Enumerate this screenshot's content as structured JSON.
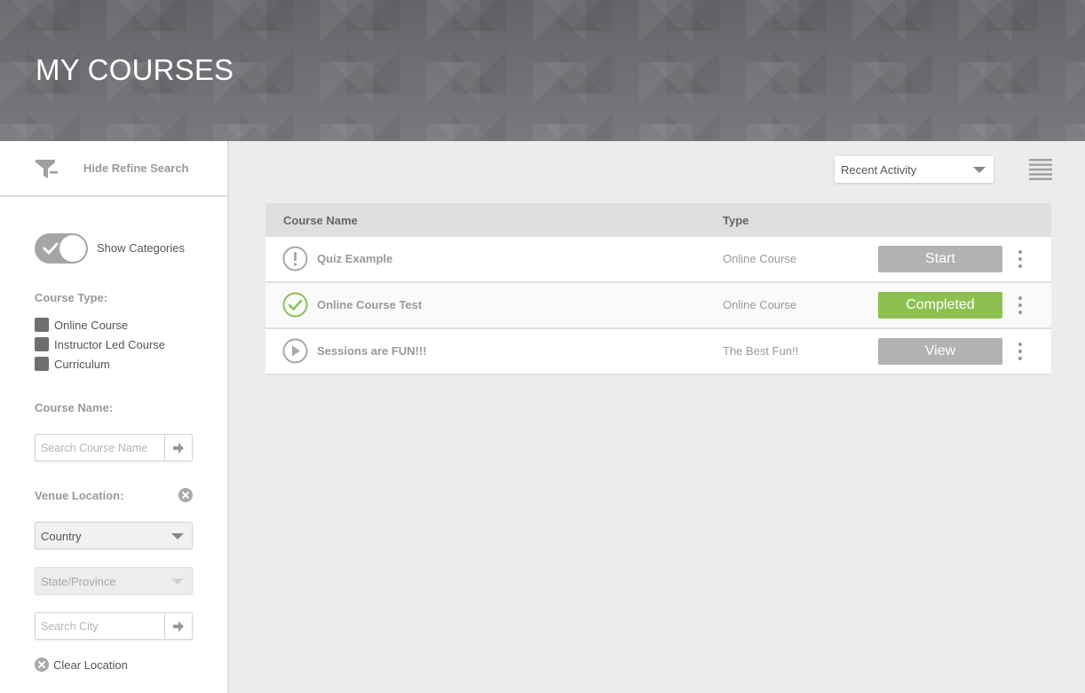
{
  "header": {
    "title": "MY COURSES"
  },
  "sidebar": {
    "refine_label": "Hide Refine Search",
    "show_categories_label": "Show Categories",
    "show_categories_on": true,
    "course_type": {
      "label": "Course Type:",
      "options": [
        {
          "label": "Online Course"
        },
        {
          "label": "Instructor Led Course"
        },
        {
          "label": "Curriculum"
        }
      ]
    },
    "course_name": {
      "label": "Course Name:",
      "placeholder": "Search Course Name"
    },
    "venue": {
      "label": "Venue Location:",
      "country": "Country",
      "state": "State/Province",
      "city_placeholder": "Search City",
      "clear_label": "Clear Location"
    }
  },
  "main": {
    "sort": {
      "selected": "Recent Activity"
    },
    "table": {
      "headers": {
        "name": "Course Name",
        "type": "Type"
      },
      "rows": [
        {
          "name": "Quiz Example",
          "type": "Online Course",
          "action": "Start",
          "status": "alert"
        },
        {
          "name": "Online Course Test",
          "type": "Online Course",
          "action": "Completed",
          "status": "completed"
        },
        {
          "name": "Sessions are FUN!!!",
          "type": "The Best Fun!!",
          "action": "View",
          "status": "play"
        }
      ]
    }
  },
  "colors": {
    "completed_green": "#8cc152",
    "button_gray": "#b2b2b2",
    "header_gray": "#6f7174"
  },
  "icons": [
    "funnel-icon",
    "check-icon",
    "arrow-right-icon",
    "close-icon",
    "chevron-down-icon",
    "list-view-icon",
    "alert-icon",
    "check-circle-icon",
    "play-icon",
    "more-vertical-icon"
  ]
}
